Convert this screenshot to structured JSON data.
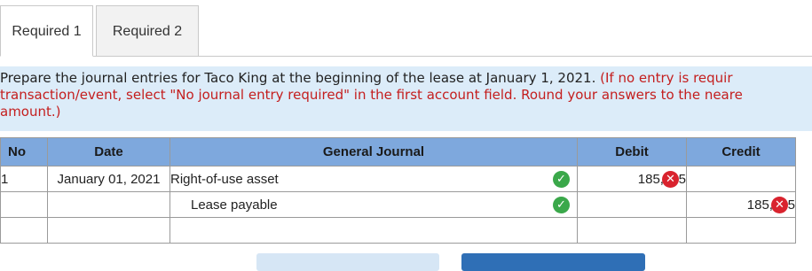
{
  "tabs": [
    {
      "label": "Required 1",
      "active": true
    },
    {
      "label": "Required 2",
      "active": false
    }
  ],
  "instructions": {
    "line1_main": "Prepare the journal entries for Taco King at the beginning of the lease at January 1, 2021.",
    "line1_hint": "(If no entry is requir",
    "line2": "transaction/event, select \"No journal entry required\" in the first account field. Round your answers to the neare",
    "line3": "amount.)"
  },
  "table": {
    "headers": {
      "no": "No",
      "date": "Date",
      "general_journal": "General Journal",
      "debit": "Debit",
      "credit": "Credit"
    },
    "rows": [
      {
        "no": "1",
        "date": "January 01, 2021",
        "account": "Right-of-use asset",
        "account_status": "check-icon",
        "debit": "185,905",
        "debit_status": "x-icon",
        "credit": "",
        "credit_status": ""
      },
      {
        "no": "",
        "date": "",
        "account": "Lease payable",
        "account_status": "check-icon",
        "debit": "",
        "debit_status": "",
        "credit": "185,905",
        "credit_status": "x-icon"
      },
      {
        "no": "",
        "date": "",
        "account": "",
        "account_status": "",
        "debit": "",
        "debit_status": "",
        "credit": "",
        "credit_status": ""
      }
    ]
  },
  "colors": {
    "header_bg": "#7ea8dd",
    "instructions_bg": "#dcecf9",
    "hint_text": "#c41e1e",
    "correct": "#3aa84a",
    "incorrect": "#d9232e"
  }
}
